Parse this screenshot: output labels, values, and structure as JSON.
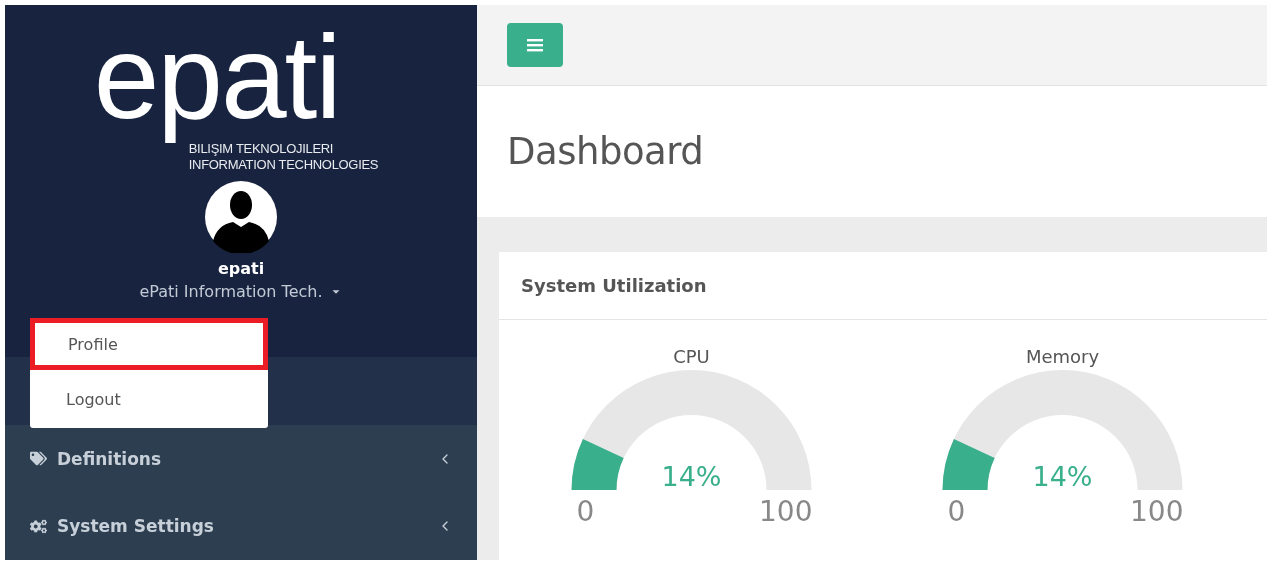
{
  "sidebar": {
    "logo": {
      "wordmark": "epati",
      "line_1": "BILIŞIM TEKNOLOJILERI",
      "line_2": "INFORMATION TECHNOLOGIES"
    },
    "user": {
      "name": "epati",
      "organization": "ePati Information Tech."
    },
    "user_menu": [
      {
        "label": "Profile",
        "highlighted": true
      },
      {
        "label": "Logout",
        "highlighted": false
      }
    ],
    "items": [
      {
        "label": "Definitions",
        "kind": "tags",
        "expanded": false
      },
      {
        "label": "System Settings",
        "kind": "cogs",
        "expanded": false
      }
    ]
  },
  "page": {
    "title": "Dashboard"
  },
  "card": {
    "title": "System Utilization",
    "gauges": [
      {
        "label": "CPU",
        "level": 0.14,
        "reading": "14%",
        "min": "0",
        "max": "100"
      },
      {
        "label": "Memory",
        "level": 0.14,
        "reading": "14%",
        "min": "0",
        "max": "100"
      }
    ]
  }
}
